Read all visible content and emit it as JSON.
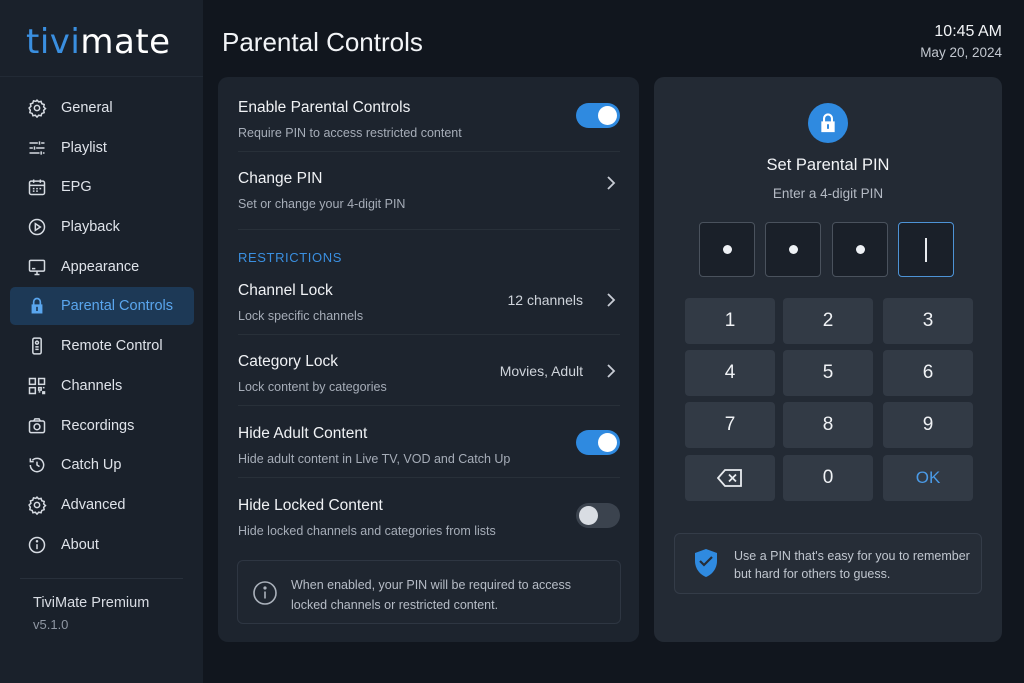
{
  "app": {
    "logo_part1": "tivi",
    "logo_part2": "mate",
    "accent": "#2f8ae0"
  },
  "header": {
    "title": "Parental Controls",
    "time": "10:45 AM",
    "date": "May 20, 2024"
  },
  "sidebar": {
    "items": [
      {
        "label": "General",
        "icon": "gear-icon"
      },
      {
        "label": "Playlist",
        "icon": "playlist-icon"
      },
      {
        "label": "EPG",
        "icon": "calendar-icon"
      },
      {
        "label": "Playback",
        "icon": "play-circle-icon"
      },
      {
        "label": "Appearance",
        "icon": "monitor-icon"
      },
      {
        "label": "Parental Controls",
        "icon": "lock-icon",
        "active": true
      },
      {
        "label": "Remote Control",
        "icon": "remote-icon"
      },
      {
        "label": "Channels",
        "icon": "grid-icon"
      },
      {
        "label": "Recordings",
        "icon": "camera-icon"
      },
      {
        "label": "Catch Up",
        "icon": "history-icon"
      },
      {
        "label": "Advanced",
        "icon": "gear-icon"
      },
      {
        "label": "About",
        "icon": "info-icon"
      }
    ],
    "footer": {
      "product": "TiviMate Premium",
      "version": "v5.1.0"
    }
  },
  "settings": {
    "enable": {
      "title": "Enable Parental Controls",
      "sub": "Require PIN to access restricted content",
      "on": true
    },
    "change_pin": {
      "title": "Change PIN",
      "sub": "Set or change your 4-digit PIN"
    },
    "section": "RESTRICTIONS",
    "channel_lock": {
      "title": "Channel Lock",
      "sub": "Lock specific channels",
      "value": "12 channels"
    },
    "category_lock": {
      "title": "Category Lock",
      "sub": "Lock content by categories",
      "value": "Movies, Adult"
    },
    "hide_adult": {
      "title": "Hide Adult Content",
      "sub": "Hide adult content in Live TV, VOD and Catch Up",
      "on": true
    },
    "hide_locked": {
      "title": "Hide Locked Content",
      "sub": "Hide locked channels and categories from lists",
      "on": false
    },
    "info": "When enabled, your PIN will be required to access locked channels or restricted content."
  },
  "pin": {
    "title": "Set Parental PIN",
    "subtitle": "Enter a 4-digit PIN",
    "entered_digits": 3,
    "keys": [
      "1",
      "2",
      "3",
      "4",
      "5",
      "6",
      "7",
      "8",
      "9",
      "⌫",
      "0",
      "OK"
    ],
    "tip": "Use a PIN that's easy for you to remember but hard for others to guess."
  }
}
